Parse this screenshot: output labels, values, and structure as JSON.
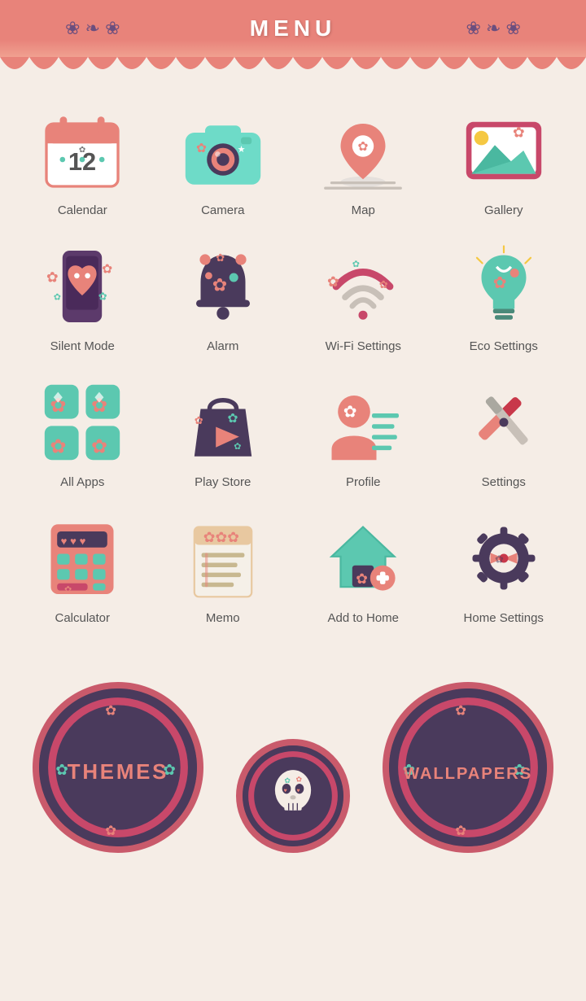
{
  "header": {
    "title": "MENU",
    "accent_color": "#e8837a",
    "deco_color": "#6b4e7e"
  },
  "grid": {
    "items": [
      {
        "id": "calendar",
        "label": "Calendar",
        "icon": "calendar"
      },
      {
        "id": "camera",
        "label": "Camera",
        "icon": "camera"
      },
      {
        "id": "map",
        "label": "Map",
        "icon": "map"
      },
      {
        "id": "gallery",
        "label": "Gallery",
        "icon": "gallery"
      },
      {
        "id": "silent-mode",
        "label": "Silent Mode",
        "icon": "silent"
      },
      {
        "id": "alarm",
        "label": "Alarm",
        "icon": "alarm"
      },
      {
        "id": "wifi-settings",
        "label": "Wi-Fi Settings",
        "icon": "wifi"
      },
      {
        "id": "eco-settings",
        "label": "Eco Settings",
        "icon": "eco"
      },
      {
        "id": "all-apps",
        "label": "All Apps",
        "icon": "allapps"
      },
      {
        "id": "play-store",
        "label": "Play Store",
        "icon": "playstore"
      },
      {
        "id": "profile",
        "label": "Profile",
        "icon": "profile"
      },
      {
        "id": "settings",
        "label": "Settings",
        "icon": "settings"
      },
      {
        "id": "calculator",
        "label": "Calculator",
        "icon": "calculator"
      },
      {
        "id": "memo",
        "label": "Memo",
        "icon": "memo"
      },
      {
        "id": "add-to-home",
        "label": "Add to Home",
        "icon": "addtohome"
      },
      {
        "id": "home-settings",
        "label": "Home Settings",
        "icon": "homesettings"
      }
    ]
  },
  "bottom": {
    "themes_label": "THEMES",
    "wallpapers_label": "WALLPAPERS"
  }
}
